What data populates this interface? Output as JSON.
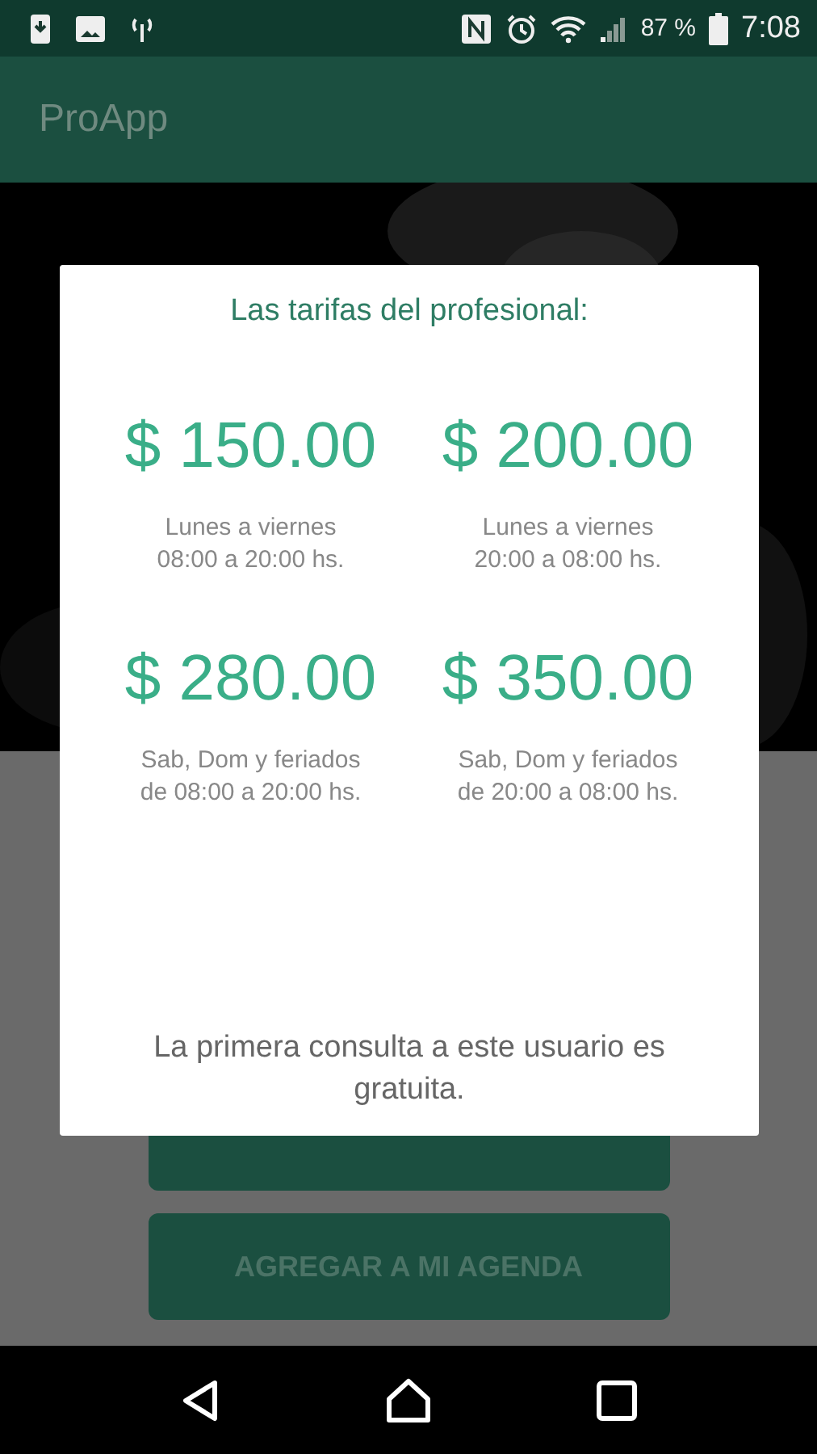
{
  "status_bar": {
    "battery": "87 %",
    "time": "7:08"
  },
  "app_bar": {
    "title": "ProApp"
  },
  "background": {
    "kind": "picture",
    "buttons": [
      {
        "label": "AGREGAR A MI AGENDA"
      }
    ]
  },
  "dialog": {
    "title": "Las tarifas del profesional:",
    "rates": [
      {
        "price": "$ 150.00",
        "lines": [
          "Lunes a viernes",
          "08:00 a 20:00 hs."
        ]
      },
      {
        "price": "$ 200.00",
        "lines": [
          "Lunes a viernes",
          "20:00 a 08:00 hs."
        ]
      },
      {
        "price": "$ 280.00",
        "lines": [
          "Sab, Dom y feriados",
          "de 08:00 a 20:00 hs."
        ]
      },
      {
        "price": "$ 350.00",
        "lines": [
          "Sab, Dom y feriados",
          "de 20:00 a 08:00 hs."
        ]
      }
    ],
    "note": "La primera consulta a este usuario es gratuita."
  }
}
